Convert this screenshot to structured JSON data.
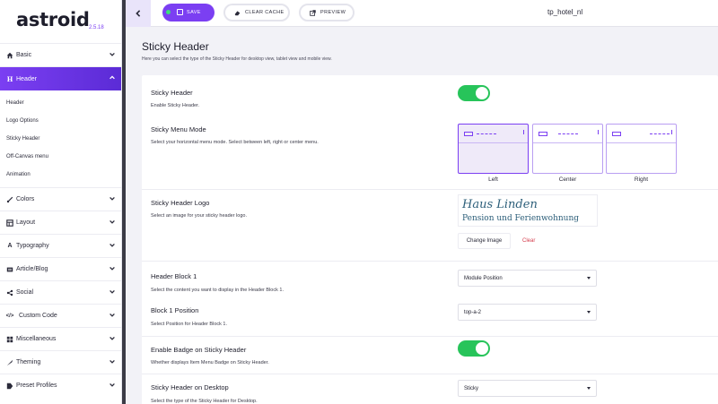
{
  "app": {
    "logo": "astroid",
    "version": "2.5.18"
  },
  "sidebar": {
    "items": [
      {
        "label": "Basic",
        "icon": "home-icon"
      },
      {
        "label": "Header",
        "icon": "header-icon",
        "active": true,
        "children": [
          "Header",
          "Logo Options",
          "Sticky Header",
          "Off-Canvas menu",
          "Animation"
        ]
      },
      {
        "label": "Colors",
        "icon": "brush-icon"
      },
      {
        "label": "Layout",
        "icon": "layout-icon"
      },
      {
        "label": "Typography",
        "icon": "typography-icon"
      },
      {
        "label": "Article/Blog",
        "icon": "article-icon"
      },
      {
        "label": "Social",
        "icon": "social-icon"
      },
      {
        "label": "Custom Code",
        "icon": "code-icon"
      },
      {
        "label": "Miscellaneous",
        "icon": "misc-icon"
      },
      {
        "label": "Theming",
        "icon": "theming-icon"
      },
      {
        "label": "Preset Profiles",
        "icon": "preset-icon"
      }
    ]
  },
  "toolbar": {
    "save_label": "SAVE",
    "clear_cache_label": "CLEAR CACHE",
    "preview_label": "PREVIEW",
    "site_name": "tp_hotel_nl"
  },
  "page": {
    "title": "Sticky Header",
    "subtitle": "Here you can select the type of the Sticky Header for desktop view, tablet view and mobile view."
  },
  "settings": {
    "sticky_header": {
      "label": "Sticky Header",
      "desc": "Enable Sticky Header.",
      "enabled": true
    },
    "menu_mode": {
      "label": "Sticky Menu Mode",
      "desc": "Select your horizontal menu mode. Select between left, right or center menu.",
      "options": [
        "Left",
        "Center",
        "Right"
      ],
      "selected": "Left"
    },
    "logo": {
      "label": "Sticky Header Logo",
      "desc": "Select an image for your sticky header logo.",
      "image_line1": "Haus Linden",
      "image_line2": "Pension und Ferienwohnung",
      "change_label": "Change Image",
      "clear_label": "Clear"
    },
    "header_block_1": {
      "label": "Header Block 1",
      "desc": "Select the content you want to display in the Header Block 1.",
      "value": "Module Position"
    },
    "block_1_position": {
      "label": "Block 1 Position",
      "desc": "Select Position for Header Block 1.",
      "value": "top-a-2"
    },
    "enable_badge": {
      "label": "Enable Badge on Sticky Header",
      "desc": "Whether displays Item Menu Badge on Sticky Header.",
      "enabled": true
    },
    "sticky_desktop": {
      "label": "Sticky Header on Desktop",
      "desc": "Select the type of the Sticky Header for Desktop.",
      "value": "Sticky"
    }
  },
  "colors": {
    "accent": "#7b3ff2",
    "toggle_on": "#27c45a",
    "danger": "#d43b4b"
  }
}
